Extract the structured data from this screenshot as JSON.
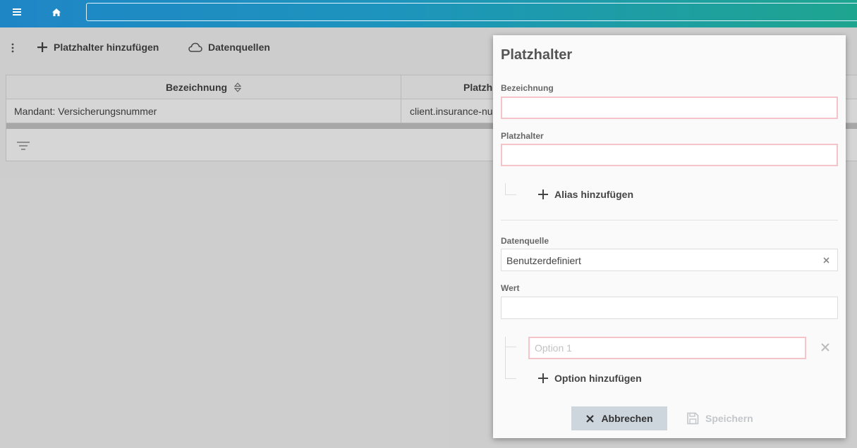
{
  "toolbar": {
    "add_placeholder_label": "Platzhalter hinzufügen",
    "data_sources_label": "Datenquellen"
  },
  "table": {
    "columns": [
      "Bezeichnung",
      "Platzh"
    ],
    "rows": [
      [
        "Mandant: Versicherungsnummer",
        "client.insurance-nu"
      ]
    ]
  },
  "dialog": {
    "title": "Platzhalter",
    "name_label": "Bezeichnung",
    "name_value": "",
    "placeholder_label": "Platzhalter",
    "placeholder_value": "",
    "add_alias_label": "Alias hinzufügen",
    "datasource_label": "Datenquelle",
    "datasource_value": "Benutzerdefiniert",
    "value_label": "Wert",
    "value_value": "",
    "option_placeholder": "Option 1",
    "add_option_label": "Option hinzufügen",
    "cancel_label": "Abbrechen",
    "save_label": "Speichern"
  },
  "colors": {
    "topbar_start": "#1f86c6",
    "topbar_end": "#1ea58f",
    "error_border": "#f4c4c8",
    "cancel_bg": "#cdd6dd"
  }
}
